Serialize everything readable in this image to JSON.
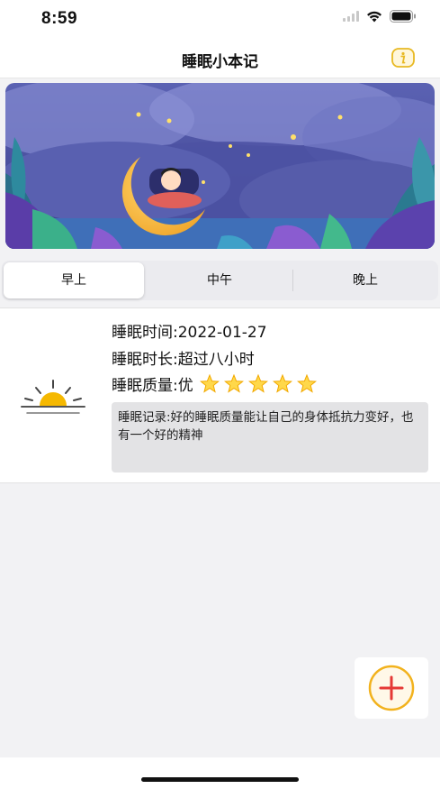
{
  "status_bar": {
    "time": "8:59"
  },
  "nav": {
    "title": "睡眠小本记",
    "info_icon": "info-icon"
  },
  "banner": {
    "description_icon": "moon-sleep-illustration"
  },
  "tabs": [
    {
      "label": "早上",
      "selected": true
    },
    {
      "label": "中午",
      "selected": false
    },
    {
      "label": "晚上",
      "selected": false
    }
  ],
  "record": {
    "time_line": "睡眠时间:2022-01-27",
    "duration_line": "睡眠时长:超过八小时",
    "quality_line": "睡眠质量:优",
    "quality_stars": 5,
    "note": "睡眠记录:好的睡眠质量能让自己的身体抵抗力变好，也有一个好的精神",
    "icon": "sunrise-icon"
  },
  "add_button": {
    "icon": "plus-circle-icon"
  },
  "colors": {
    "accent": "#e8b923",
    "add_red": "#e53935",
    "night_bg": "#4a4f9a"
  }
}
